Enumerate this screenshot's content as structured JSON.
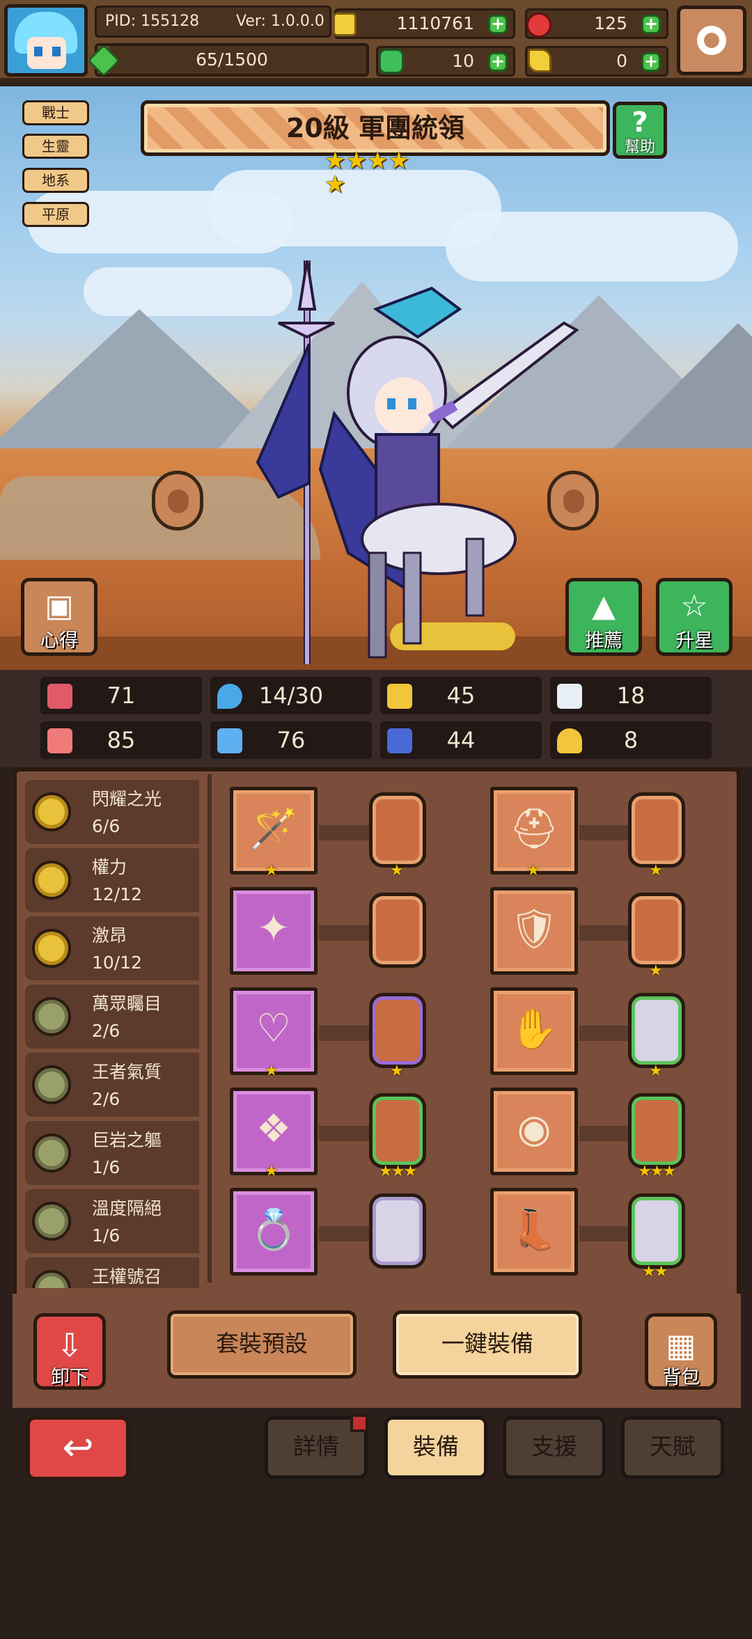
{
  "header": {
    "pid": "PID: 155128",
    "version": "Ver: 1.0.0.0",
    "xp": "65/1500",
    "xp_fraction": 0.043,
    "coins": "1110761",
    "rubies": "125",
    "clovers": "10",
    "keys": "0"
  },
  "tags": [
    "戰士",
    "生靈",
    "地系",
    "平原"
  ],
  "hero": {
    "title": "20級  軍團統領",
    "stars": 5,
    "help_label": "幫助"
  },
  "scene_buttons": {
    "notes_label": "心得",
    "recommend_label": "推薦",
    "star_up_label": "升星"
  },
  "stats": [
    {
      "icon": "heart-icon",
      "value": "71",
      "color": "#e05a6a"
    },
    {
      "icon": "water-drop-icon",
      "value": "14/30",
      "color": "#4aa8e8"
    },
    {
      "icon": "shield-icon",
      "value": "45",
      "color": "#f2c53a"
    },
    {
      "icon": "wing-icon",
      "value": "18",
      "color": "#e8eef6"
    },
    {
      "icon": "fist-icon",
      "value": "85",
      "color": "#f07a7a"
    },
    {
      "icon": "book-icon",
      "value": "76",
      "color": "#5fb0f0"
    },
    {
      "icon": "scroll-icon",
      "value": "44",
      "color": "#4a6ad8"
    },
    {
      "icon": "horseshoe-icon",
      "value": "8",
      "color": "#f2c53a"
    }
  ],
  "sets": [
    {
      "name": "閃耀之光",
      "count": "6/6",
      "active": true
    },
    {
      "name": "權力",
      "count": "12/12",
      "active": true
    },
    {
      "name": "激昂",
      "count": "10/12",
      "active": true
    },
    {
      "name": "萬眾矚目",
      "count": "2/6",
      "active": false
    },
    {
      "name": "王者氣質",
      "count": "2/6",
      "active": false
    },
    {
      "name": "巨岩之軀",
      "count": "1/6",
      "active": false
    },
    {
      "name": "溫度隔絕",
      "count": "1/6",
      "active": false
    },
    {
      "name": "王權號召",
      "count": "",
      "active": false
    }
  ],
  "actions": {
    "unequip_label": "卸下",
    "set_preset_label": "套裝預設",
    "auto_equip_label": "一鍵裝備",
    "bag_label": "背包"
  },
  "tabs": {
    "details": "詳情",
    "equipment": "裝備",
    "support": "支援",
    "talent": "天賦"
  }
}
